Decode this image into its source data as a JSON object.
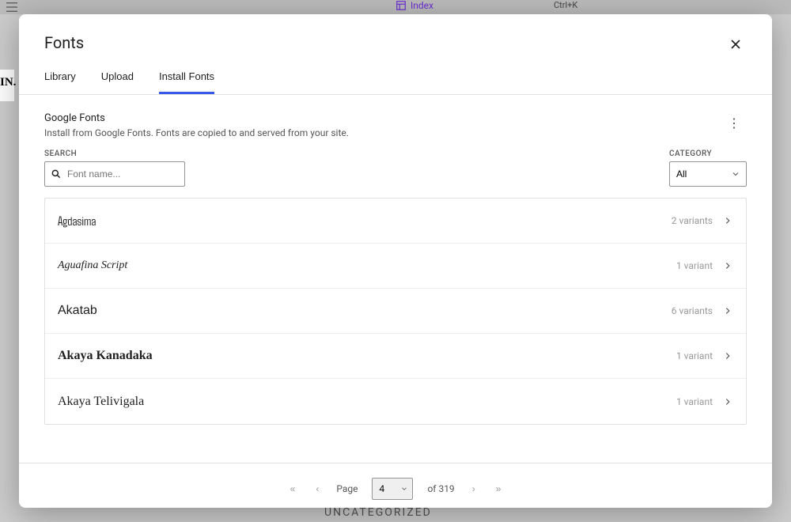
{
  "bg": {
    "index": "Index",
    "shortcut": "Ctrl+K",
    "uncategorized": "UNCATEGORIZED",
    "left_text": "IN."
  },
  "modal": {
    "title": "Fonts"
  },
  "tabs": [
    {
      "label": "Library"
    },
    {
      "label": "Upload"
    },
    {
      "label": "Install Fonts",
      "active": true
    }
  ],
  "provider": {
    "title": "Google Fonts",
    "desc": "Install from Google Fonts. Fonts are copied to and served from your site."
  },
  "search": {
    "label": "SEARCH",
    "placeholder": "Font name..."
  },
  "category": {
    "label": "CATEGORY",
    "selected": "All"
  },
  "fonts": [
    {
      "name": "Agdasima",
      "variants": "2 variants",
      "cls": "ff-agdasima"
    },
    {
      "name": "Aguafina Script",
      "variants": "1 variant",
      "cls": "ff-aguafina"
    },
    {
      "name": "Akatab",
      "variants": "6 variants",
      "cls": "ff-akatab"
    },
    {
      "name": "Akaya Kanadaka",
      "variants": "1 variant",
      "cls": "ff-akaya-k"
    },
    {
      "name": "Akaya Telivigala",
      "variants": "1 variant",
      "cls": "ff-akaya-t"
    }
  ],
  "pager": {
    "page_label": "Page",
    "current": "4",
    "of_label": "of 319"
  }
}
